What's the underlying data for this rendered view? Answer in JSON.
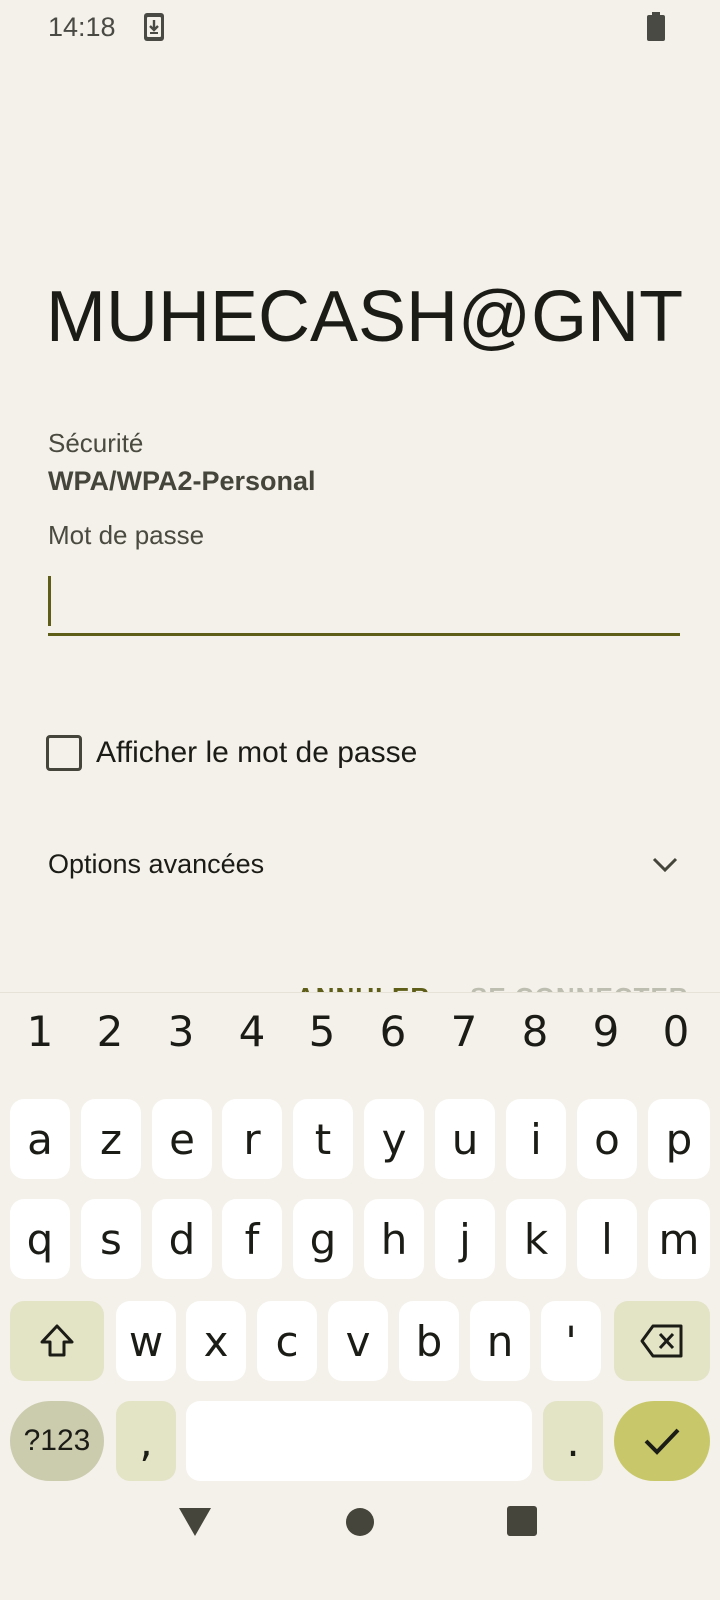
{
  "status_bar": {
    "time": "14:18",
    "download_icon": "download-notification-icon",
    "battery_icon": "battery-icon"
  },
  "dialog": {
    "network_name": "MUHECASH@GNT",
    "security_label": "Sécurité",
    "security_value": "WPA/WPA2-Personal",
    "password_label": "Mot de passe",
    "password_value": "",
    "show_password_label": "Afficher le mot de passe",
    "show_password_checked": false,
    "advanced_options_label": "Options avancées",
    "cancel_label": "ANNULER",
    "connect_label": "SE CONNECTER"
  },
  "keyboard": {
    "numbers": [
      "1",
      "2",
      "3",
      "4",
      "5",
      "6",
      "7",
      "8",
      "9",
      "0"
    ],
    "row1": [
      "a",
      "z",
      "e",
      "r",
      "t",
      "y",
      "u",
      "i",
      "o",
      "p"
    ],
    "row2": [
      "q",
      "s",
      "d",
      "f",
      "g",
      "h",
      "j",
      "k",
      "l",
      "m"
    ],
    "row3": [
      "w",
      "x",
      "c",
      "v",
      "b",
      "n",
      "'"
    ],
    "symbols_label": "?123",
    "comma_label": ",",
    "period_label": ".",
    "space_label": "",
    "colors": {
      "key": "#ffffff",
      "modifier": "#e3e3c6",
      "symbols": "#cbcbae",
      "enter": "#c8c86a"
    }
  },
  "nav_bar": {
    "back_icon": "back-triangle-icon",
    "home_icon": "home-circle-icon",
    "recents_icon": "recents-square-icon"
  },
  "colors": {
    "background": "#f4f1ea",
    "accent": "#5e5e18"
  }
}
